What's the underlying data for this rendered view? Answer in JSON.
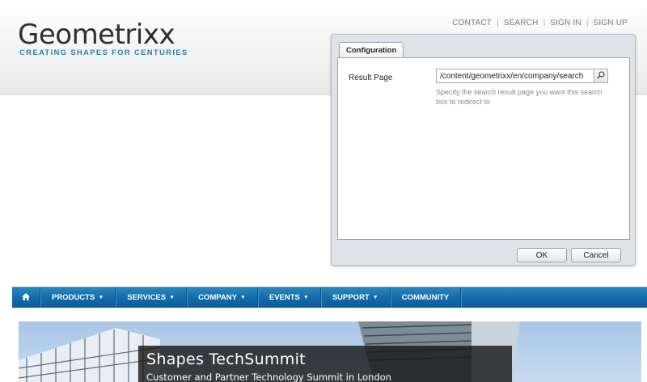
{
  "header": {
    "logo_word": "Geometrixx",
    "logo_tagline": "CREATING SHAPES FOR CENTURIES",
    "links": [
      "CONTACT",
      "SEARCH",
      "SIGN IN",
      "SIGN UP"
    ]
  },
  "dialog": {
    "tab_label": "Configuration",
    "field_label": "Result Page",
    "field_value": "/content/geometrixx/en/company/search",
    "field_help": "Specify the search result page you want this search box to redirect to",
    "ok_label": "OK",
    "cancel_label": "Cancel"
  },
  "nav": {
    "home_icon": "home-icon",
    "items": [
      "PRODUCTS",
      "SERVICES",
      "COMPANY",
      "EVENTS",
      "SUPPORT",
      "COMMUNITY"
    ],
    "caret": "▼"
  },
  "hero": {
    "title": "Shapes TechSummit",
    "subtitle": "Customer and Partner Technology Summit in London"
  },
  "colors": {
    "brand_blue": "#2b7fb9",
    "nav_blue": "#126aa6"
  }
}
